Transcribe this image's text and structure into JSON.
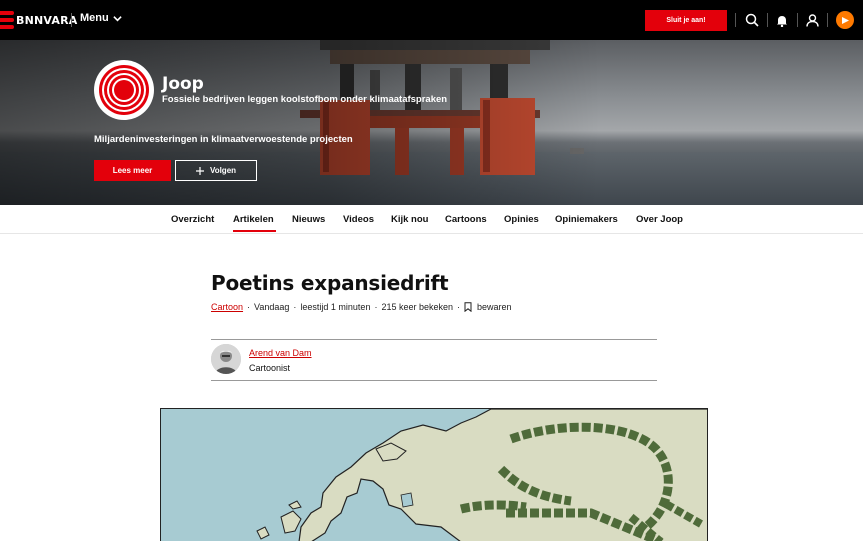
{
  "topbar": {
    "logo_text": "BNNVARA",
    "menu_label": "Menu",
    "cta_label": "Sluit je aan!",
    "icons": [
      "search-icon",
      "bell-icon",
      "user-icon",
      "npo-icon"
    ]
  },
  "hero": {
    "brand_name": "Joop",
    "brand_subtitle": "Fossiele bedrijven leggen koolstofbom onder klimaatafspraken",
    "description": "Miljardeninvesteringen in klimaatverwoestende projecten",
    "read_more_label": "Lees meer",
    "follow_label": "Volgen"
  },
  "nav": {
    "items": [
      {
        "label": "Overzicht"
      },
      {
        "label": "Artikelen"
      },
      {
        "label": "Nieuws"
      },
      {
        "label": "Videos"
      },
      {
        "label": "Kijk nou"
      },
      {
        "label": "Cartoons"
      },
      {
        "label": "Opinies"
      },
      {
        "label": "Opiniemakers"
      },
      {
        "label": "Over Joop"
      }
    ],
    "active": "Artikelen"
  },
  "article": {
    "title": "Poetins expansiedrift",
    "category": "Cartoon",
    "date": "Vandaag",
    "reading_time": "leestijd 1 minuten",
    "views": "215 keer bekeken",
    "save_label": "bewaren",
    "author": {
      "name": "Arend van Dam",
      "role": "Cartoonist"
    }
  },
  "colors": {
    "accent": "#e3000b",
    "topbar_bg": "#000000",
    "npo_orange": "#ff7a00"
  }
}
